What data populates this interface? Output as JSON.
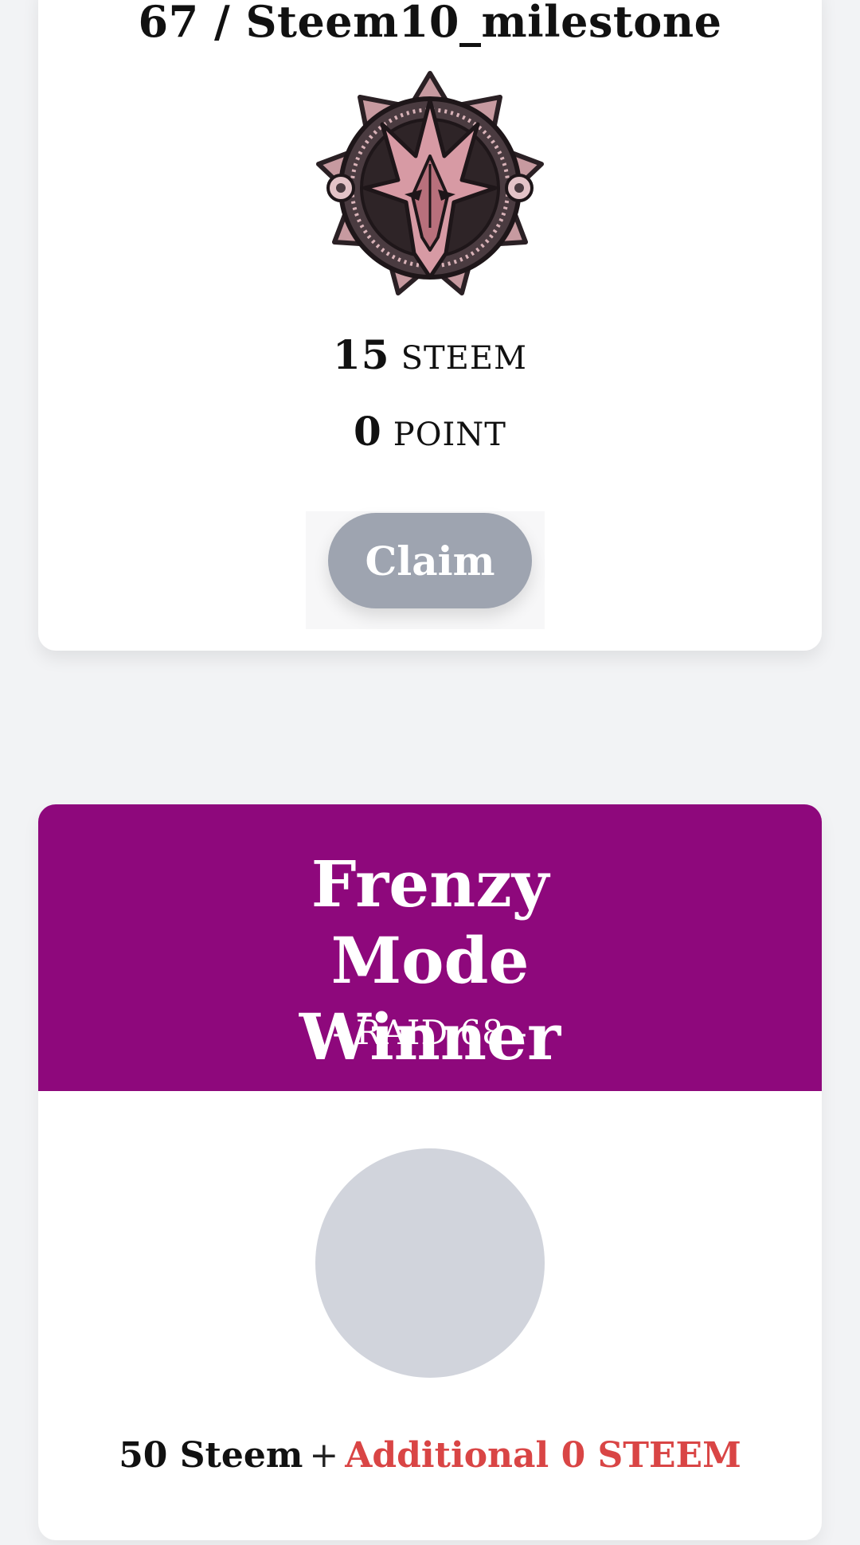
{
  "milestone_card": {
    "title": "67 / Steem10_milestone",
    "badge_icon": "dragon-emblem-icon",
    "reward_steem_value": "15",
    "reward_steem_unit": "STEEM",
    "reward_point_value": "0",
    "reward_point_unit": "POINT",
    "claim_label": "Claim",
    "claim_color": "#9ea4b0"
  },
  "frenzy_card": {
    "title": "Frenzy Mode Winner",
    "subtitle": "- RAID 68 -",
    "header_color": "#8e087c",
    "avatar_placeholder_color": "#d1d4dc",
    "prize_base": "50 Steem",
    "prize_plus": "+",
    "prize_additional": "Additional 0 STEEM",
    "prize_additional_color": "#d94545"
  }
}
